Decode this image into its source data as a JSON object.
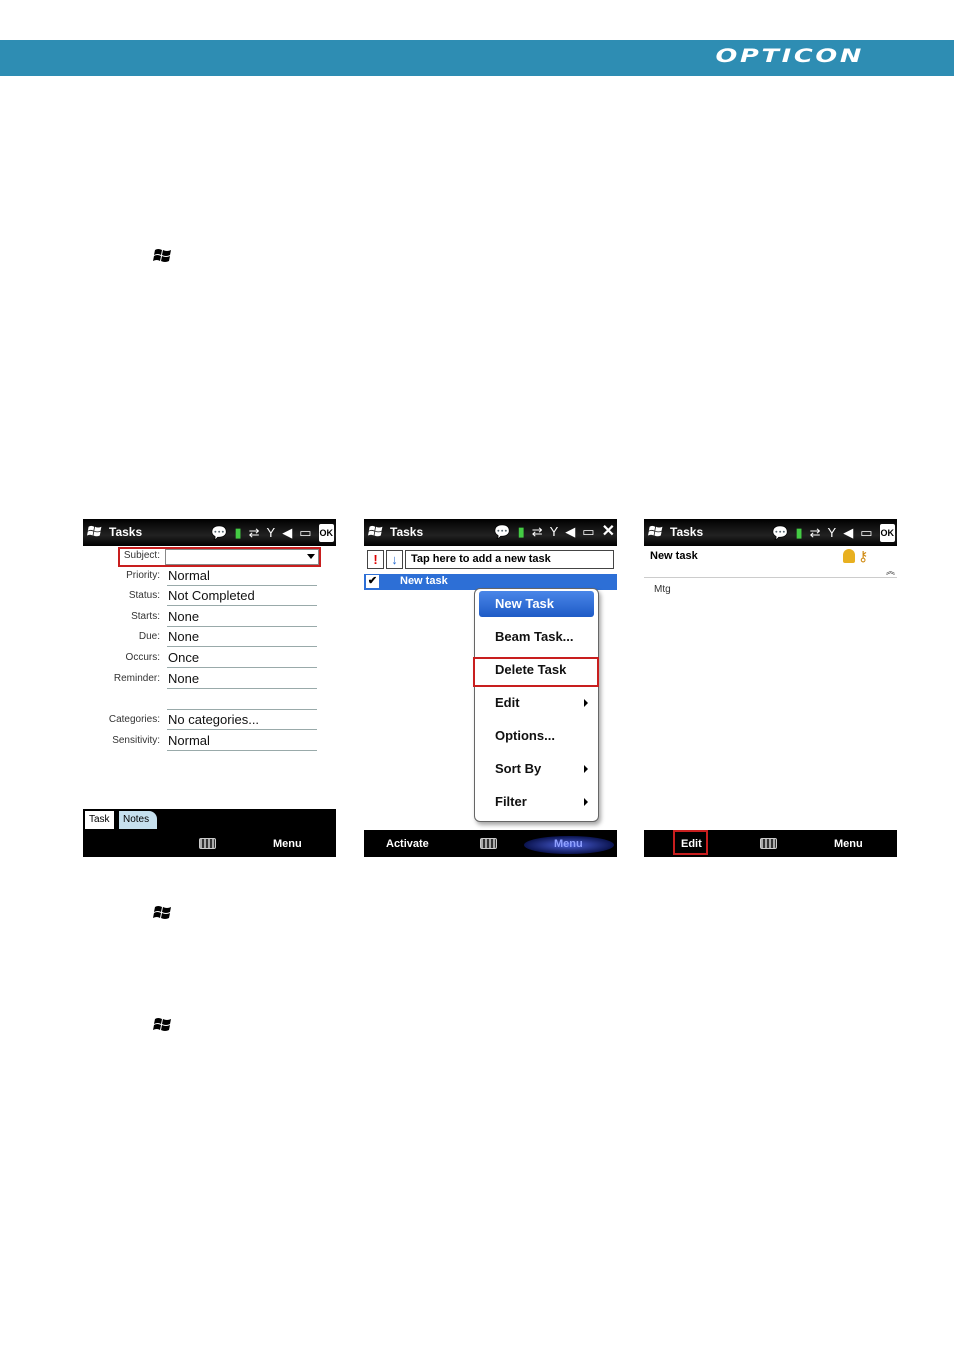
{
  "header": {
    "brand": "OPTICON",
    "color": "#2e8db3"
  },
  "screens": {
    "s1": {
      "title": "Tasks",
      "rows": [
        {
          "label": "Subject:",
          "value": ""
        },
        {
          "label": "Priority:",
          "value": "Normal"
        },
        {
          "label": "Status:",
          "value": "Not Completed"
        },
        {
          "label": "Starts:",
          "value": "None"
        },
        {
          "label": "Due:",
          "value": "None"
        },
        {
          "label": "Occurs:",
          "value": "Once"
        },
        {
          "label": "Reminder:",
          "value": "None"
        },
        {
          "label": "Categories:",
          "value": "No categories..."
        },
        {
          "label": "Sensitivity:",
          "value": "Normal"
        }
      ],
      "tabs": [
        "Task",
        "Notes"
      ],
      "softkey_right": "Menu"
    },
    "s2": {
      "title": "Tasks",
      "priority_high": "!",
      "priority_low": "↓",
      "add_placeholder": "Tap here to add a new task",
      "task": "New task",
      "menu": [
        {
          "label": "New Task",
          "submenu": false
        },
        {
          "label": "Beam Task...",
          "submenu": false
        },
        {
          "label": "Delete Task",
          "submenu": false
        },
        {
          "label": "Edit",
          "submenu": true
        },
        {
          "label": "Options...",
          "submenu": false
        },
        {
          "label": "Sort By",
          "submenu": true
        },
        {
          "label": "Filter",
          "submenu": true
        }
      ],
      "softkey_left": "Activate",
      "softkey_right": "Menu"
    },
    "s3": {
      "title": "Tasks",
      "task_title": "New task",
      "note": "Mtg",
      "softkey_left": "Edit",
      "softkey_right": "Menu"
    }
  },
  "icons": [
    "windows-logo-icon",
    "message-icon",
    "battery-icon",
    "sync-icon",
    "signal-icon",
    "speaker-icon",
    "connection-icon",
    "ok-icon",
    "close-icon",
    "keyboard-icon",
    "bell-icon",
    "key-icon",
    "collapse-icon",
    "checkbox-icon"
  ],
  "accent_colors": {
    "highlight_box": "#c81e1e",
    "selection": "#2d6fd6"
  }
}
